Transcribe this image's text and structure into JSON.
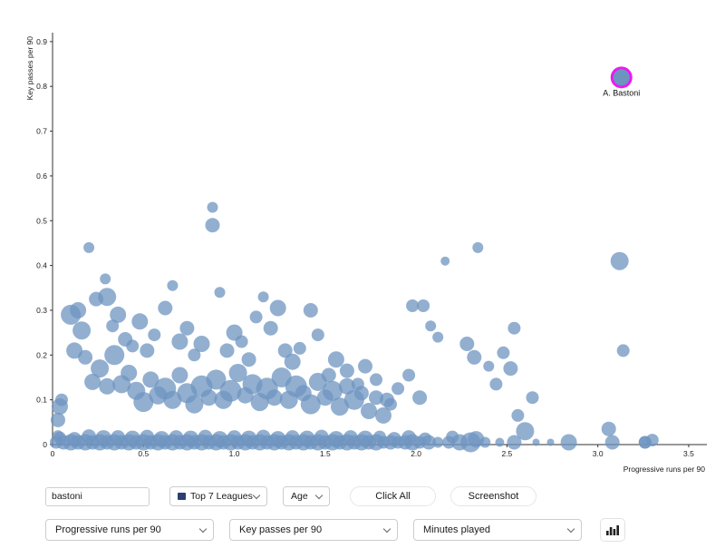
{
  "chart_data": {
    "type": "scatter",
    "title": "",
    "xlabel": "Progressive runs per 90",
    "ylabel": "Key passes per 90",
    "xlim": [
      0,
      3.6
    ],
    "ylim": [
      0,
      0.92
    ],
    "xticks": [
      "0",
      "0.5",
      "1.0",
      "1.5",
      "2.0",
      "2.5",
      "3.0",
      "3.5"
    ],
    "xtick_values": [
      0,
      0.5,
      1.0,
      1.5,
      2.0,
      2.5,
      3.0,
      3.5
    ],
    "yticks": [
      "0",
      "0.1",
      "0.2",
      "0.3",
      "0.4",
      "0.5",
      "0.6",
      "0.7",
      "0.8",
      "0.9"
    ],
    "ytick_values": [
      0,
      0.1,
      0.2,
      0.3,
      0.4,
      0.5,
      0.6,
      0.7,
      0.8,
      0.9
    ],
    "grid": false,
    "legend": "none",
    "size_encodes": "Minutes played",
    "marker_color": "#6d94c0",
    "marker_opacity": 0.75,
    "highlight": {
      "label": "A. Bastoni",
      "x": 3.13,
      "y": 0.82,
      "r": 9,
      "ring_color": "#e81cf0",
      "fill_color": "#6d94c0"
    },
    "points": [
      [
        0.02,
        0.005,
        7
      ],
      [
        0.06,
        0.005,
        8
      ],
      [
        0.1,
        0.005,
        9
      ],
      [
        0.14,
        0.005,
        8
      ],
      [
        0.18,
        0.005,
        9
      ],
      [
        0.22,
        0.005,
        8
      ],
      [
        0.26,
        0.005,
        9
      ],
      [
        0.3,
        0.005,
        8
      ],
      [
        0.34,
        0.005,
        9
      ],
      [
        0.38,
        0.005,
        8
      ],
      [
        0.42,
        0.005,
        9
      ],
      [
        0.46,
        0.005,
        8
      ],
      [
        0.5,
        0.005,
        9
      ],
      [
        0.54,
        0.005,
        8
      ],
      [
        0.58,
        0.005,
        9
      ],
      [
        0.62,
        0.005,
        8
      ],
      [
        0.66,
        0.005,
        9
      ],
      [
        0.7,
        0.005,
        8
      ],
      [
        0.74,
        0.005,
        9
      ],
      [
        0.78,
        0.005,
        8
      ],
      [
        0.82,
        0.005,
        9
      ],
      [
        0.86,
        0.005,
        8
      ],
      [
        0.9,
        0.005,
        9
      ],
      [
        0.94,
        0.005,
        8
      ],
      [
        0.98,
        0.005,
        9
      ],
      [
        1.02,
        0.005,
        8
      ],
      [
        1.06,
        0.005,
        9
      ],
      [
        1.1,
        0.005,
        8
      ],
      [
        1.14,
        0.005,
        9
      ],
      [
        1.18,
        0.005,
        8
      ],
      [
        1.22,
        0.005,
        9
      ],
      [
        1.26,
        0.005,
        8
      ],
      [
        1.3,
        0.005,
        9
      ],
      [
        1.34,
        0.005,
        8
      ],
      [
        1.38,
        0.005,
        9
      ],
      [
        1.42,
        0.005,
        8
      ],
      [
        1.46,
        0.005,
        9
      ],
      [
        1.5,
        0.005,
        8
      ],
      [
        1.54,
        0.005,
        9
      ],
      [
        1.58,
        0.005,
        8
      ],
      [
        1.62,
        0.005,
        9
      ],
      [
        1.66,
        0.005,
        8
      ],
      [
        1.7,
        0.005,
        9
      ],
      [
        1.74,
        0.005,
        8
      ],
      [
        1.78,
        0.005,
        9
      ],
      [
        1.82,
        0.005,
        7
      ],
      [
        1.86,
        0.005,
        8
      ],
      [
        1.9,
        0.005,
        7
      ],
      [
        1.94,
        0.005,
        8
      ],
      [
        1.98,
        0.005,
        9
      ],
      [
        2.02,
        0.005,
        7
      ],
      [
        2.07,
        0.005,
        8
      ],
      [
        2.12,
        0.005,
        6
      ],
      [
        2.18,
        0.005,
        7
      ],
      [
        2.24,
        0.005,
        9
      ],
      [
        2.3,
        0.005,
        11
      ],
      [
        2.38,
        0.005,
        6
      ],
      [
        2.46,
        0.005,
        5
      ],
      [
        2.54,
        0.005,
        8
      ],
      [
        2.66,
        0.005,
        4
      ],
      [
        2.74,
        0.005,
        4
      ],
      [
        2.84,
        0.005,
        9
      ],
      [
        3.08,
        0.005,
        8
      ],
      [
        3.26,
        0.005,
        7
      ],
      [
        0.04,
        0.015,
        7
      ],
      [
        0.12,
        0.012,
        8
      ],
      [
        0.2,
        0.018,
        8
      ],
      [
        0.28,
        0.014,
        9
      ],
      [
        0.36,
        0.016,
        8
      ],
      [
        0.44,
        0.013,
        9
      ],
      [
        0.52,
        0.017,
        8
      ],
      [
        0.6,
        0.012,
        9
      ],
      [
        0.68,
        0.016,
        8
      ],
      [
        0.76,
        0.013,
        9
      ],
      [
        0.84,
        0.017,
        8
      ],
      [
        0.92,
        0.012,
        9
      ],
      [
        1.0,
        0.016,
        8
      ],
      [
        1.08,
        0.013,
        9
      ],
      [
        1.16,
        0.017,
        8
      ],
      [
        1.24,
        0.012,
        9
      ],
      [
        1.32,
        0.016,
        8
      ],
      [
        1.4,
        0.013,
        9
      ],
      [
        1.48,
        0.017,
        8
      ],
      [
        1.56,
        0.012,
        9
      ],
      [
        1.64,
        0.016,
        8
      ],
      [
        1.72,
        0.013,
        9
      ],
      [
        1.8,
        0.017,
        7
      ],
      [
        1.88,
        0.012,
        8
      ],
      [
        1.96,
        0.016,
        8
      ],
      [
        2.05,
        0.013,
        7
      ],
      [
        2.2,
        0.017,
        7
      ],
      [
        2.33,
        0.012,
        9
      ],
      [
        0.03,
        0.02,
        6
      ],
      [
        0.03,
        0.055,
        8
      ],
      [
        0.05,
        0.1,
        7
      ],
      [
        0.04,
        0.085,
        9
      ],
      [
        0.12,
        0.21,
        9
      ],
      [
        0.14,
        0.3,
        9
      ],
      [
        0.16,
        0.255,
        10
      ],
      [
        0.1,
        0.29,
        11
      ],
      [
        0.18,
        0.195,
        8
      ],
      [
        0.22,
        0.14,
        9
      ],
      [
        0.26,
        0.17,
        10
      ],
      [
        0.3,
        0.13,
        9
      ],
      [
        0.34,
        0.2,
        11
      ],
      [
        0.38,
        0.135,
        10
      ],
      [
        0.42,
        0.16,
        9
      ],
      [
        0.46,
        0.12,
        10
      ],
      [
        0.5,
        0.095,
        11
      ],
      [
        0.54,
        0.145,
        9
      ],
      [
        0.58,
        0.11,
        10
      ],
      [
        0.62,
        0.125,
        12
      ],
      [
        0.66,
        0.1,
        10
      ],
      [
        0.7,
        0.155,
        9
      ],
      [
        0.74,
        0.115,
        11
      ],
      [
        0.78,
        0.09,
        10
      ],
      [
        0.82,
        0.13,
        12
      ],
      [
        0.86,
        0.105,
        9
      ],
      [
        0.9,
        0.145,
        11
      ],
      [
        0.94,
        0.1,
        10
      ],
      [
        0.98,
        0.12,
        12
      ],
      [
        1.02,
        0.16,
        10
      ],
      [
        1.06,
        0.11,
        9
      ],
      [
        1.1,
        0.135,
        11
      ],
      [
        1.14,
        0.095,
        10
      ],
      [
        1.18,
        0.125,
        12
      ],
      [
        1.22,
        0.105,
        9
      ],
      [
        1.26,
        0.15,
        11
      ],
      [
        1.3,
        0.1,
        10
      ],
      [
        1.34,
        0.13,
        12
      ],
      [
        1.38,
        0.115,
        9
      ],
      [
        1.42,
        0.09,
        11
      ],
      [
        1.46,
        0.14,
        10
      ],
      [
        1.5,
        0.105,
        9
      ],
      [
        1.54,
        0.12,
        11
      ],
      [
        1.58,
        0.085,
        10
      ],
      [
        1.62,
        0.13,
        9
      ],
      [
        1.66,
        0.1,
        11
      ],
      [
        1.7,
        0.115,
        8
      ],
      [
        1.74,
        0.075,
        9
      ],
      [
        1.78,
        0.105,
        8
      ],
      [
        1.82,
        0.065,
        9
      ],
      [
        1.86,
        0.09,
        7
      ],
      [
        0.2,
        0.44,
        6
      ],
      [
        0.29,
        0.37,
        6
      ],
      [
        0.24,
        0.325,
        8
      ],
      [
        0.3,
        0.33,
        10
      ],
      [
        0.33,
        0.265,
        7
      ],
      [
        0.36,
        0.29,
        9
      ],
      [
        0.4,
        0.235,
        8
      ],
      [
        0.44,
        0.22,
        7
      ],
      [
        0.48,
        0.275,
        9
      ],
      [
        0.52,
        0.21,
        8
      ],
      [
        0.56,
        0.245,
        7
      ],
      [
        0.62,
        0.305,
        8
      ],
      [
        0.66,
        0.355,
        6
      ],
      [
        0.7,
        0.23,
        9
      ],
      [
        0.74,
        0.26,
        8
      ],
      [
        0.78,
        0.2,
        7
      ],
      [
        0.82,
        0.225,
        9
      ],
      [
        0.88,
        0.53,
        6
      ],
      [
        0.88,
        0.49,
        8
      ],
      [
        0.92,
        0.34,
        6
      ],
      [
        0.96,
        0.21,
        8
      ],
      [
        1.0,
        0.25,
        9
      ],
      [
        1.04,
        0.23,
        7
      ],
      [
        1.08,
        0.19,
        8
      ],
      [
        1.12,
        0.285,
        7
      ],
      [
        1.16,
        0.33,
        6
      ],
      [
        1.2,
        0.26,
        8
      ],
      [
        1.24,
        0.305,
        9
      ],
      [
        1.28,
        0.21,
        8
      ],
      [
        1.32,
        0.185,
        9
      ],
      [
        1.36,
        0.215,
        7
      ],
      [
        1.42,
        0.3,
        8
      ],
      [
        1.46,
        0.245,
        7
      ],
      [
        1.52,
        0.155,
        8
      ],
      [
        1.56,
        0.19,
        9
      ],
      [
        1.62,
        0.165,
        8
      ],
      [
        1.68,
        0.135,
        7
      ],
      [
        1.72,
        0.175,
        8
      ],
      [
        1.78,
        0.145,
        7
      ],
      [
        1.84,
        0.1,
        8
      ],
      [
        1.9,
        0.125,
        7
      ],
      [
        1.96,
        0.155,
        7
      ],
      [
        2.02,
        0.105,
        8
      ],
      [
        1.98,
        0.31,
        7
      ],
      [
        2.04,
        0.31,
        7
      ],
      [
        2.08,
        0.265,
        6
      ],
      [
        2.12,
        0.24,
        6
      ],
      [
        2.16,
        0.41,
        5
      ],
      [
        2.28,
        0.225,
        8
      ],
      [
        2.32,
        0.195,
        8
      ],
      [
        2.34,
        0.44,
        6
      ],
      [
        2.4,
        0.175,
        6
      ],
      [
        2.44,
        0.135,
        7
      ],
      [
        2.48,
        0.205,
        7
      ],
      [
        2.54,
        0.26,
        7
      ],
      [
        2.52,
        0.17,
        8
      ],
      [
        2.56,
        0.065,
        7
      ],
      [
        2.6,
        0.03,
        10
      ],
      [
        2.64,
        0.105,
        7
      ],
      [
        3.06,
        0.035,
        8
      ],
      [
        3.12,
        0.41,
        10
      ],
      [
        3.14,
        0.21,
        7
      ],
      [
        3.26,
        0.005,
        7
      ],
      [
        3.3,
        0.01,
        7
      ]
    ]
  },
  "controls": {
    "search": {
      "value": "bastoni",
      "placeholder": ""
    },
    "league_select": {
      "label": "Top 7 Leagues",
      "swatch_color": "#2b3f73"
    },
    "age_select": {
      "label": "Age"
    },
    "click_all_button": "Click All",
    "screenshot_button": "Screenshot",
    "x_select": {
      "label": "Progressive runs per 90"
    },
    "y_select": {
      "label": "Key passes per 90"
    },
    "size_select": {
      "label": "Minutes played"
    },
    "chart_button": {
      "icon": "bar-chart-icon"
    }
  }
}
